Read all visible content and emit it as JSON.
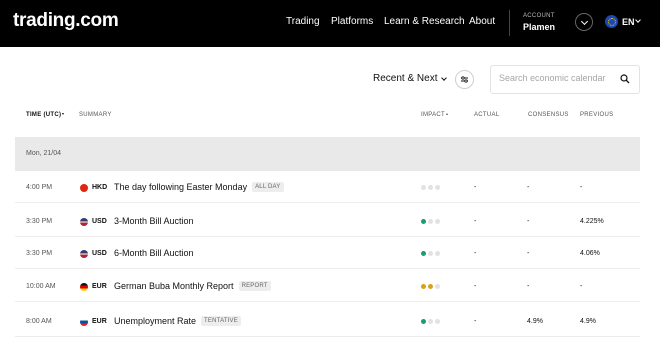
{
  "header": {
    "logo": "trading.com",
    "nav": [
      "Trading",
      "Platforms",
      "Learn & Research",
      "About"
    ],
    "account_label": "ACCOUNT",
    "account_name": "Plamen",
    "language": "EN"
  },
  "controls": {
    "recent_label": "Recent & Next",
    "search_placeholder": "Search economic calendar"
  },
  "table": {
    "columns": {
      "time": "TIME (UTC)",
      "summary": "SUMMARY",
      "impact": "IMPACT",
      "actual": "ACTUAL",
      "consensus": "CONSENSUS",
      "previous": "PREVIOUS"
    },
    "date_band": "Mon, 21/04",
    "rows": [
      {
        "time": "4:00 PM",
        "currency": "HKD",
        "flag": "hk",
        "title": "The day following Easter Monday",
        "tag": "ALL DAY",
        "impact": 0,
        "impact_color": "#e2e2e2",
        "actual": "-",
        "consensus": "-",
        "previous": "-"
      },
      {
        "time": "3:30 PM",
        "currency": "USD",
        "flag": "us",
        "title": "3-Month Bill Auction",
        "tag": "",
        "impact": 1,
        "impact_color": "#1a9e6e",
        "actual": "-",
        "consensus": "-",
        "previous": "4.225%"
      },
      {
        "time": "3:30 PM",
        "currency": "USD",
        "flag": "us",
        "title": "6-Month Bill Auction",
        "tag": "",
        "impact": 1,
        "impact_color": "#1a9e6e",
        "actual": "-",
        "consensus": "-",
        "previous": "4.06%"
      },
      {
        "time": "10:00 AM",
        "currency": "EUR",
        "flag": "de",
        "title": "German Buba Monthly Report",
        "tag": "REPORT",
        "impact": 2,
        "impact_color": "#d6a21a",
        "actual": "-",
        "consensus": "-",
        "previous": "-"
      },
      {
        "time": "8:00 AM",
        "currency": "EUR",
        "flag": "sk",
        "title": "Unemployment Rate",
        "tag": "TENTATIVE",
        "impact": 1,
        "impact_color": "#1a9e6e",
        "actual": "-",
        "consensus": "4.9%",
        "previous": "4.9%"
      }
    ]
  }
}
